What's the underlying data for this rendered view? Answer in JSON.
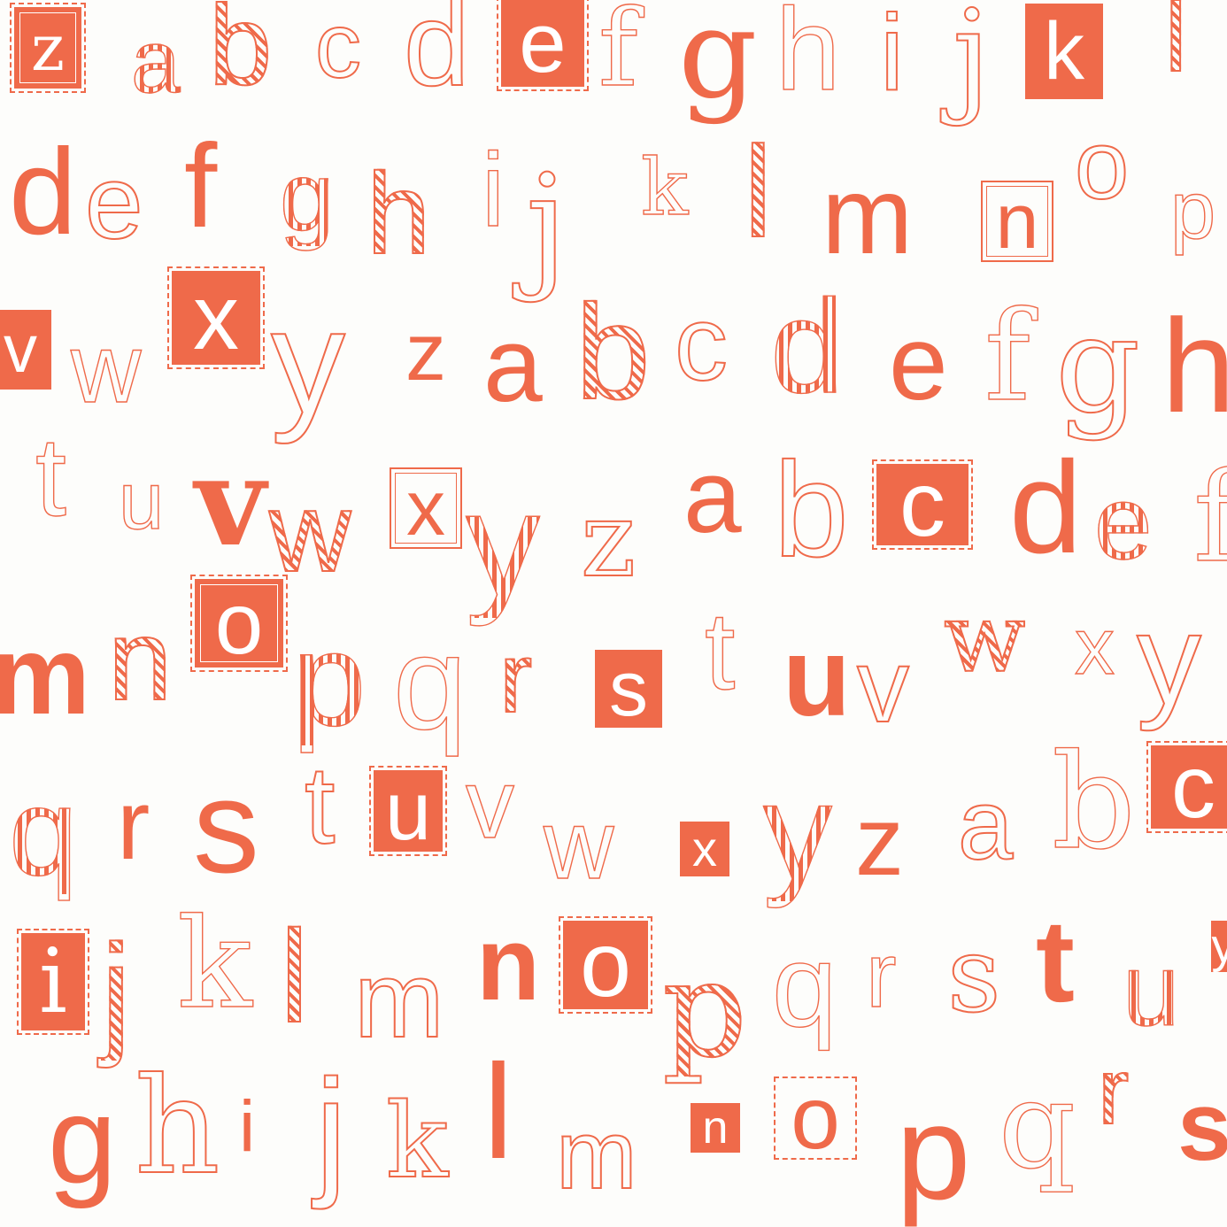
{
  "accent_color": "#ef6a4a",
  "background_color": "#fdfdfb",
  "letters": {
    "r1": [
      "z",
      "a",
      "b",
      "c",
      "d",
      "e",
      "f",
      "g",
      "h",
      "i",
      "j",
      "k",
      "l"
    ],
    "r2": [
      "d",
      "e",
      "f",
      "g",
      "h",
      "i",
      "j",
      "k",
      "l",
      "m",
      "n",
      "o",
      "p"
    ],
    "r3": [
      "v",
      "w",
      "x",
      "y",
      "z",
      "a",
      "b",
      "c",
      "d",
      "e",
      "f",
      "g",
      "h"
    ],
    "r4": [
      "t",
      "u",
      "v",
      "w",
      "x",
      "y",
      "z",
      "a",
      "b",
      "c",
      "d",
      "e",
      "f"
    ],
    "r5": [
      "m",
      "n",
      "o",
      "p",
      "q",
      "r",
      "s",
      "t",
      "u",
      "v",
      "w",
      "x",
      "y"
    ],
    "r6": [
      "q",
      "r",
      "s",
      "t",
      "u",
      "v",
      "w",
      "x",
      "y",
      "z",
      "a",
      "b",
      "c"
    ],
    "r7": [
      "i",
      "j",
      "k",
      "l",
      "m",
      "n",
      "o",
      "p",
      "q",
      "r",
      "s",
      "t",
      "u",
      "y"
    ],
    "r8": [
      "g",
      "h",
      "i",
      "j",
      "k",
      "l",
      "m",
      "n",
      "o",
      "p",
      "q",
      "r",
      "s"
    ]
  }
}
